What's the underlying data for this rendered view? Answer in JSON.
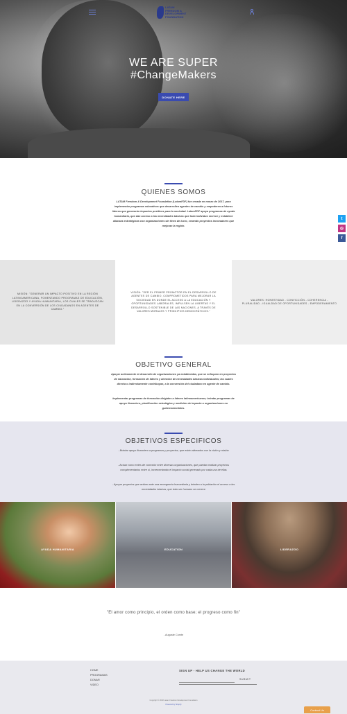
{
  "header": {
    "logo_text": [
      "LATAM",
      "FREEDOM &",
      "DEVELOPMENT",
      "FOUNDATION"
    ]
  },
  "hero": {
    "title_line1": "WE ARE SUPER",
    "title_line2": "#ChangeMakers",
    "donate_label": "DONATE HERE"
  },
  "quienes": {
    "title": "QUIENES SOMOS",
    "text": "LATAM Freedom & Development Foundation (LatamFDF) fue creada en marzo de 2017, para implementar programas educativos que desarrollen agentes de cambio y empoderen a futuros líderes que generarán impactos positivos para la sociedad. LatamFDF apoya programas de ayuda humanitaria, que dan acceso a las necesidades básicas que todo individuo merece y establece alianzas estratégicas con organizaciones sin fines de lucro, creando proyectos innovadores que mejoran la región."
  },
  "social": {
    "twitter": "t",
    "instagram": "◎",
    "facebook": "f"
  },
  "values": {
    "mision": "Misión: \"Generar un impacto positivo en la región latinoamericana, fomentando programas de educación, liderazgo y ayuda humanitaria, los cuales se traduzcan en la conversión de los ciudadanos en agentes de cambio.\"",
    "vision": "Visión: \"Ser el primer promotor en el desarrollo de agentes de cambio, comprometidos para mejorar la sociedad en donde el acceso a la educación y oportunidades laborales, impulsen la libertad y el desarrollo sostenible de las naciones, a través de valores morales y principios democráticos.\"",
    "valores": "Valores: Honestidad - Convicción - Coherencia - Pluralidad - Igualdad de oportunidades - Empoderamiento"
  },
  "objetivo_general": {
    "title": "OBJETIVO GENERAL",
    "text1": "Apoyar activamente el desarrollo de organizaciones ya establecidas, que se enfoquen en proyectos de educación, formación de líderes y atención de necesidades básicas individuales; las cuales directa o indirectamente contribuyan, a la conversión del ciudadano en agente de cambio.",
    "text2": "Implementar programas de formación dirigidos a líderes latinoamericanos; brindar programas de apoyo financiero, planificación estratégica y medición de impacto a organizaciones no gubernamentales."
  },
  "objetivos_especificos": {
    "title": "OBJETIVOS ESPECIFICOS",
    "items": [
      "- Brindar apoyo financiero a programas y proyectos, que estén alineados con la visión y misión",
      "- Actuar como entes de conexión entre diversas organizaciones, que puedan realizar proyectos complementarios entre sí, incrementando el impacto social generado por cada una de ellas",
      "- Apoyar proyectos que actúen ante una emergencia humanitaria y brinden a la población el acceso a las necesidades básicas, que todo ser humano se merece"
    ]
  },
  "tiles": [
    {
      "label": "AYUDA HUMANITARIA"
    },
    {
      "label": "EDUCATION"
    },
    {
      "label": "LIDERAZGO"
    }
  ],
  "quote": {
    "text": "\"El amor como principio, el orden como base; el progreso como fin\"",
    "author": "- Auguste Comte"
  },
  "footer": {
    "nav": [
      "HOME",
      "PROGRAMAS",
      "DONAR",
      "VIDEO"
    ],
    "signup_title": "SIGN UP - HELP US CHANGE THE WORLD",
    "email_placeholder": "",
    "submit_label": "SUBMIT",
    "copyright": "Copyright © 2018 Latam Freedom Development Foundation",
    "powered": "Powered by Shopify",
    "contact_label": "Contact Us"
  },
  "colors": {
    "accent": "#3a4bb0",
    "contact": "#e8a04a",
    "twitter": "#1da1f2",
    "instagram": "#c13584",
    "facebook": "#3b5998"
  }
}
